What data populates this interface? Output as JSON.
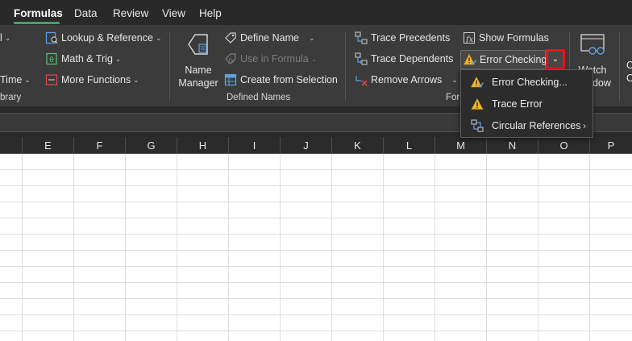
{
  "tabs": [
    {
      "label": "Formulas",
      "active": true
    },
    {
      "label": "Data"
    },
    {
      "label": "Review"
    },
    {
      "label": "View"
    },
    {
      "label": "Help"
    }
  ],
  "function_library": {
    "partial_top": "l",
    "partial_bottom": "Time",
    "lookup_reference": "Lookup & Reference",
    "math_trig": "Math & Trig",
    "more_functions": "More Functions",
    "group_label": "brary"
  },
  "defined_names": {
    "name_manager_line1": "Name",
    "name_manager_line2": "Manager",
    "define_name": "Define Name",
    "use_in_formula": "Use in Formula",
    "create_from_selection": "Create from Selection",
    "group_label": "Defined Names"
  },
  "formula_auditing": {
    "trace_precedents": "Trace Precedents",
    "trace_dependents": "Trace Dependents",
    "remove_arrows": "Remove Arrows",
    "show_formulas": "Show Formulas",
    "error_checking": "Error Checking",
    "group_label_partial": "For"
  },
  "watch": {
    "line1": "Watch",
    "line2": "ndow",
    "partial_right_top": "C",
    "partial_right_bottom": "O"
  },
  "dropdown": {
    "items": [
      {
        "label": "Error Checking...",
        "icon": "error-checking-icon"
      },
      {
        "label": "Trace Error",
        "icon": "warning-icon"
      },
      {
        "label": "Circular References",
        "icon": "circular-references-icon",
        "submenu": true
      }
    ]
  },
  "columns": [
    "E",
    "F",
    "G",
    "H",
    "I",
    "J",
    "K",
    "L",
    "M",
    "N",
    "O",
    "P"
  ],
  "colors": {
    "accent_tab": "#3fa26b",
    "highlight_box": "#e6141c",
    "warning_yellow": "#f0b429",
    "icon_blue": "#5aa0e6"
  }
}
